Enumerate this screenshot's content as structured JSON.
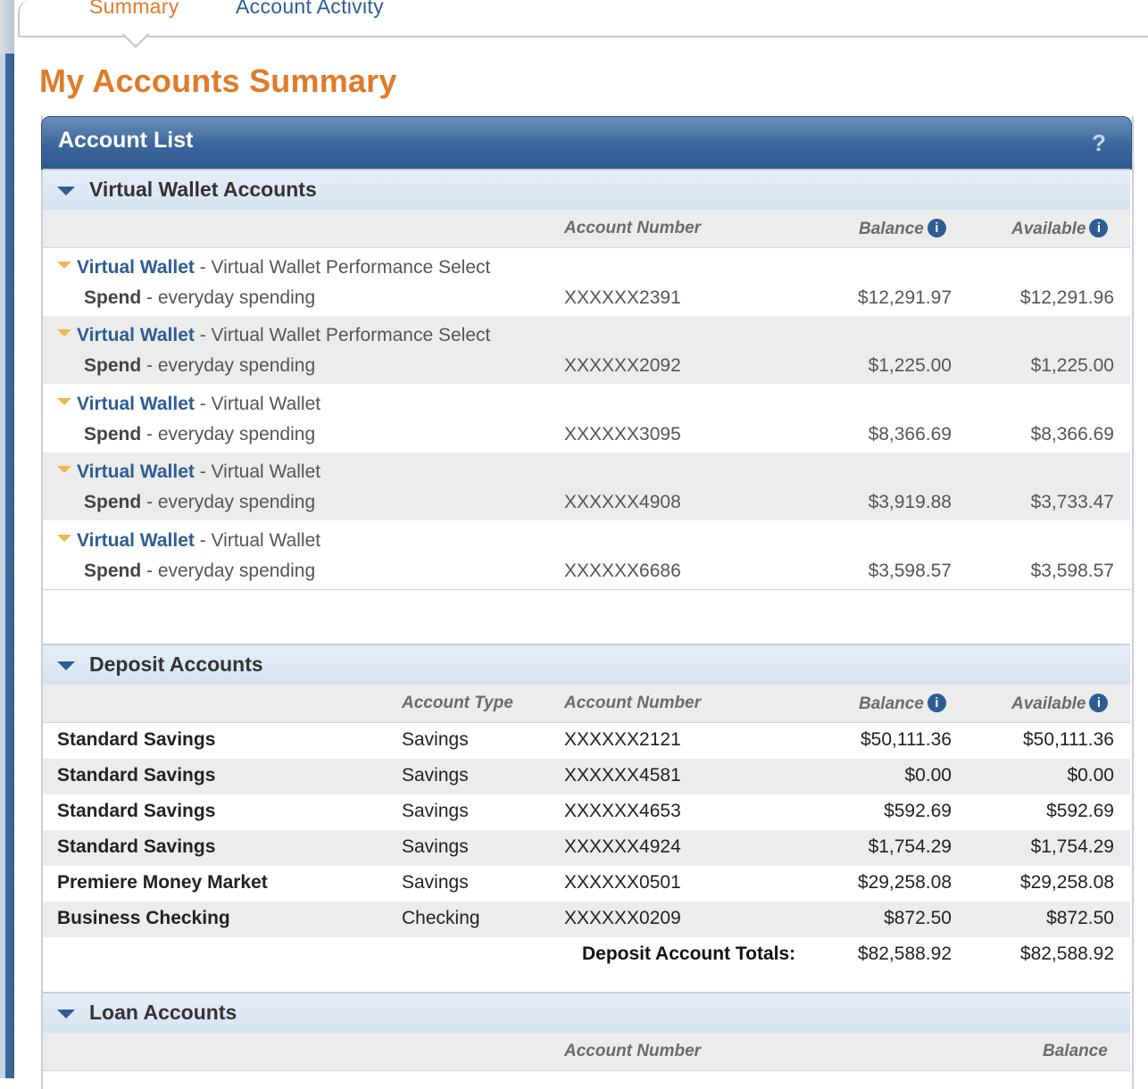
{
  "tabs": {
    "summary": "Summary",
    "activity": "Account Activity"
  },
  "page_title": "My Accounts Summary",
  "panel": {
    "title": "Account List",
    "help": "?"
  },
  "virtual_wallet": {
    "title": "Virtual Wallet Accounts",
    "col_account_number": "Account Number",
    "col_balance": "Balance",
    "col_available": "Available",
    "rows": [
      {
        "name": "Virtual Wallet",
        "desc": "- Virtual Wallet Performance Select",
        "sub_name": "Spend",
        "sub_desc": "- everyday spending",
        "number": "XXXXXX2391",
        "balance": "$12,291.97",
        "available": "$12,291.96"
      },
      {
        "name": "Virtual Wallet",
        "desc": "- Virtual Wallet Performance Select",
        "sub_name": "Spend",
        "sub_desc": "- everyday spending",
        "number": "XXXXXX2092",
        "balance": "$1,225.00",
        "available": "$1,225.00"
      },
      {
        "name": "Virtual Wallet",
        "desc": "- Virtual Wallet",
        "sub_name": "Spend",
        "sub_desc": "- everyday spending",
        "number": "XXXXXX3095",
        "balance": "$8,366.69",
        "available": "$8,366.69"
      },
      {
        "name": "Virtual Wallet",
        "desc": "- Virtual Wallet",
        "sub_name": "Spend",
        "sub_desc": "- everyday spending",
        "number": "XXXXXX4908",
        "balance": "$3,919.88",
        "available": "$3,733.47"
      },
      {
        "name": "Virtual Wallet",
        "desc": "- Virtual Wallet",
        "sub_name": "Spend",
        "sub_desc": "- everyday spending",
        "number": "XXXXXX6686",
        "balance": "$3,598.57",
        "available": "$3,598.57"
      }
    ]
  },
  "deposit": {
    "title": "Deposit Accounts",
    "col_account_type": "Account Type",
    "col_account_number": "Account Number",
    "col_balance": "Balance",
    "col_available": "Available",
    "rows": [
      {
        "name": "Standard Savings",
        "type": "Savings",
        "number": "XXXXXX2121",
        "balance": "$50,111.36",
        "available": "$50,111.36"
      },
      {
        "name": "Standard Savings",
        "type": "Savings",
        "number": "XXXXXX4581",
        "balance": "$0.00",
        "available": "$0.00"
      },
      {
        "name": "Standard Savings",
        "type": "Savings",
        "number": "XXXXXX4653",
        "balance": "$592.69",
        "available": "$592.69"
      },
      {
        "name": "Standard Savings",
        "type": "Savings",
        "number": "XXXXXX4924",
        "balance": "$1,754.29",
        "available": "$1,754.29"
      },
      {
        "name": "Premiere Money Market",
        "type": "Savings",
        "number": "XXXXXX0501",
        "balance": "$29,258.08",
        "available": "$29,258.08"
      },
      {
        "name": "Business Checking",
        "type": "Checking",
        "number": "XXXXXX0209",
        "balance": "$872.50",
        "available": "$872.50"
      }
    ],
    "totals_label": "Deposit Account Totals:",
    "totals_balance": "$82,588.92",
    "totals_available": "$82,588.92"
  },
  "loan": {
    "title": "Loan Accounts",
    "col_account_number": "Account Number",
    "col_balance": "Balance"
  },
  "icons": {
    "info": "i",
    "collapse": "triangle-down-icon"
  },
  "colors": {
    "accent_orange": "#e07b28",
    "link_blue": "#2d5d94",
    "header_blue": "#3b669b"
  }
}
